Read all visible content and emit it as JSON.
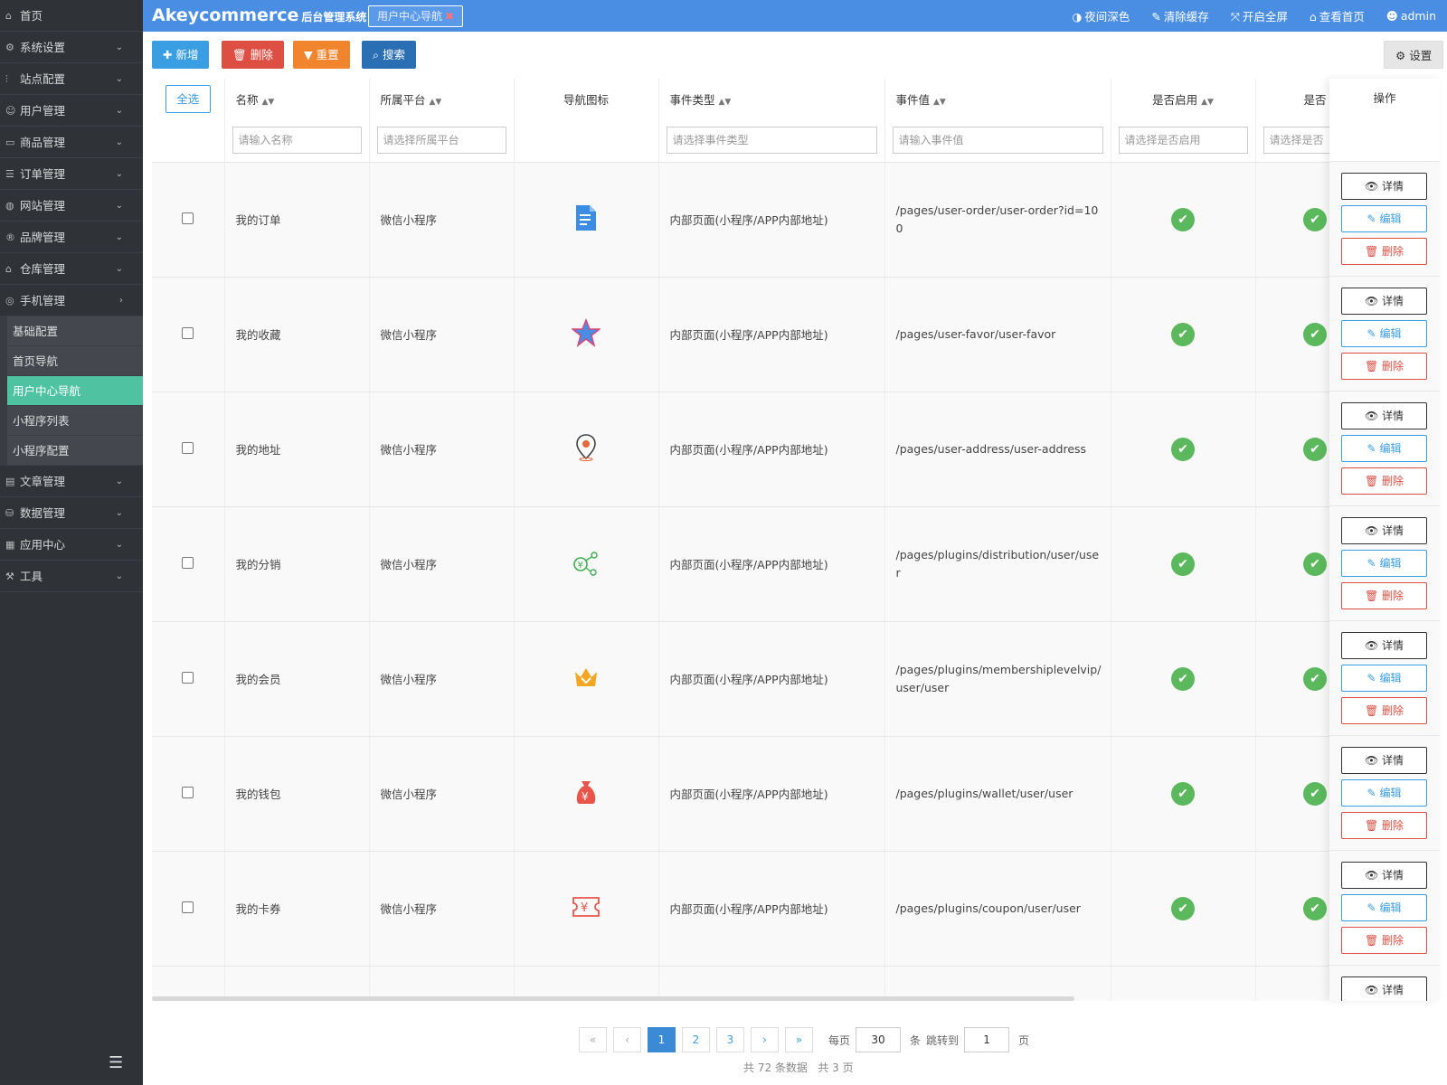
{
  "sidebar": {
    "home": "首页",
    "menus": [
      {
        "label": "系统设置",
        "icon": "gear-icon",
        "glyph": "⚙",
        "arrow": "⌄"
      },
      {
        "label": "站点配置",
        "icon": "sliders-icon",
        "glyph": "⫶",
        "arrow": "⌄"
      },
      {
        "label": "用户管理",
        "icon": "user-icon",
        "glyph": "☺",
        "arrow": "⌄"
      },
      {
        "label": "商品管理",
        "icon": "box-icon",
        "glyph": "▭",
        "arrow": "⌄"
      },
      {
        "label": "订单管理",
        "icon": "list-icon",
        "glyph": "☰",
        "arrow": "⌄"
      },
      {
        "label": "网站管理",
        "icon": "globe-icon",
        "glyph": "◍",
        "arrow": "⌄"
      },
      {
        "label": "品牌管理",
        "icon": "registered-icon",
        "glyph": "®",
        "arrow": "⌄"
      },
      {
        "label": "仓库管理",
        "icon": "warehouse-icon",
        "glyph": "⌂",
        "arrow": "⌄"
      },
      {
        "label": "手机管理",
        "icon": "phone-icon",
        "glyph": "◎",
        "arrow": "›"
      }
    ],
    "submenus": [
      "基础配置",
      "首页导航",
      "用户中心导航",
      "小程序列表",
      "小程序配置"
    ],
    "active_sub": "用户中心导航",
    "menus_after": [
      {
        "label": "文章管理",
        "icon": "article-icon",
        "glyph": "▤",
        "arrow": "⌄"
      },
      {
        "label": "数据管理",
        "icon": "database-icon",
        "glyph": "⛁",
        "arrow": "⌄"
      },
      {
        "label": "应用中心",
        "icon": "apps-icon",
        "glyph": "▦",
        "arrow": "⌄"
      },
      {
        "label": "工具",
        "icon": "tools-icon",
        "glyph": "⚒",
        "arrow": "⌄"
      }
    ]
  },
  "topbar": {
    "brand": "Akeycommerce",
    "brand_sub": "后台管理系统",
    "open_tab": "用户中心导航",
    "actions": [
      {
        "label": "夜间深色",
        "icon": "contrast-icon",
        "glyph": "◑"
      },
      {
        "label": "清除缓存",
        "icon": "brush-icon",
        "glyph": "✎"
      },
      {
        "label": "开启全屏",
        "icon": "fullscreen-icon",
        "glyph": "⤧"
      },
      {
        "label": "查看首页",
        "icon": "home-icon",
        "glyph": "⌂"
      },
      {
        "label": "admin",
        "icon": "user-icon",
        "glyph": "☻"
      }
    ]
  },
  "toolbar": {
    "add": "新增",
    "delete": "删除",
    "reset": "重置",
    "search": "搜索",
    "settings": "设置"
  },
  "table": {
    "select_all": "全选",
    "columns": [
      "名称",
      "所属平台",
      "导航图标",
      "事件类型",
      "事件值",
      "是否启用",
      "是否"
    ],
    "op_column": "操作",
    "filters": {
      "name": "请输入名称",
      "platform": "请选择所属平台",
      "event_type": "请选择事件类型",
      "event_value": "请输入事件值",
      "enabled": "请选择是否启用",
      "extra": "请选择是否"
    },
    "rows": [
      {
        "name": "我的订单",
        "platform": "微信小程序",
        "icon": "order-doc-icon",
        "event_type": "内部页面(小程序/APP内部地址)",
        "event_value": "/pages/user-order/user-order?id=100"
      },
      {
        "name": "我的收藏",
        "platform": "微信小程序",
        "icon": "star-icon",
        "event_type": "内部页面(小程序/APP内部地址)",
        "event_value": "/pages/user-favor/user-favor"
      },
      {
        "name": "我的地址",
        "platform": "微信小程序",
        "icon": "location-pin-icon",
        "event_type": "内部页面(小程序/APP内部地址)",
        "event_value": "/pages/user-address/user-address"
      },
      {
        "name": "我的分销",
        "platform": "微信小程序",
        "icon": "distribution-icon",
        "event_type": "内部页面(小程序/APP内部地址)",
        "event_value": "/pages/plugins/distribution/user/user"
      },
      {
        "name": "我的会员",
        "platform": "微信小程序",
        "icon": "crown-icon",
        "event_type": "内部页面(小程序/APP内部地址)",
        "event_value": "/pages/plugins/membershiplevelvip/user/user"
      },
      {
        "name": "我的钱包",
        "platform": "微信小程序",
        "icon": "money-bag-icon",
        "event_type": "内部页面(小程序/APP内部地址)",
        "event_value": "/pages/plugins/wallet/user/user"
      },
      {
        "name": "我的卡券",
        "platform": "微信小程序",
        "icon": "coupon-icon",
        "event_type": "内部页面(小程序/APP内部地址)",
        "event_value": "/pages/plugins/coupon/user/user"
      }
    ],
    "actions": {
      "detail": "详情",
      "edit": "编辑",
      "delete": "删除"
    }
  },
  "pagination": {
    "first": "«",
    "prev": "‹",
    "pages": [
      "1",
      "2",
      "3"
    ],
    "current": "1",
    "next": "›",
    "last": "»",
    "per_page_label": "每页",
    "per_page": "30",
    "per_page_unit": "条",
    "jump_label": "跳转到",
    "jump_value": "1",
    "jump_unit": "页",
    "summary_total": "共 72 条数据",
    "summary_pages": "共 3 页"
  }
}
